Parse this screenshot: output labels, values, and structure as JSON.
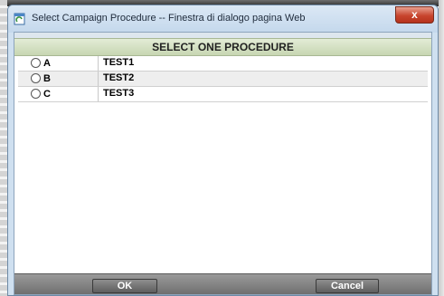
{
  "window": {
    "title": "Select Campaign Procedure -- Finestra di dialogo pagina Web",
    "close_label": "x"
  },
  "dialog": {
    "header": "SELECT ONE PROCEDURE",
    "options": [
      {
        "letter": "A",
        "procedure": "TEST1"
      },
      {
        "letter": "B",
        "procedure": "TEST2"
      },
      {
        "letter": "C",
        "procedure": "TEST3"
      }
    ]
  },
  "footer": {
    "ok_label": "OK",
    "cancel_label": "Cancel"
  }
}
